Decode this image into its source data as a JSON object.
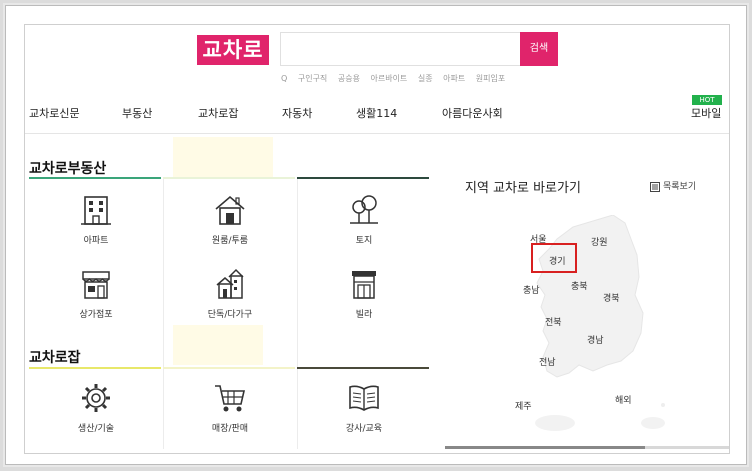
{
  "header": {
    "logo_text": "교차로",
    "search_button": "검색",
    "keywords": [
      "구인구직",
      "공승용",
      "아르바이트",
      "실종",
      "아파트",
      "원피임포"
    ]
  },
  "nav": {
    "items": [
      "교차로신문",
      "부동산",
      "교차로잡",
      "자동차",
      "생활114",
      "아름다운사회",
      "모바일"
    ],
    "hot_badge": "HOT"
  },
  "realestate": {
    "title": "교차로부동산",
    "items": [
      "아파트",
      "원룸/투룸",
      "토지",
      "상가점포",
      "단독/다가구",
      "빌라"
    ]
  },
  "jobs": {
    "title": "교차로잡",
    "items": [
      "생산/기술",
      "매장/판매",
      "강사/교육"
    ]
  },
  "region_panel": {
    "title": "지역 교차로 바로가기",
    "list_link": "목록보기",
    "regions": [
      "서울",
      "강원",
      "경기",
      "충남",
      "충북",
      "경북",
      "전북",
      "경남",
      "전남",
      "제주",
      "해외"
    ]
  },
  "colors": {
    "brand": "#e0246b",
    "hot": "#22b14c",
    "highlight": "#d82020",
    "section_green": "#3aa57a",
    "section_yellow": "#e8e86a"
  }
}
